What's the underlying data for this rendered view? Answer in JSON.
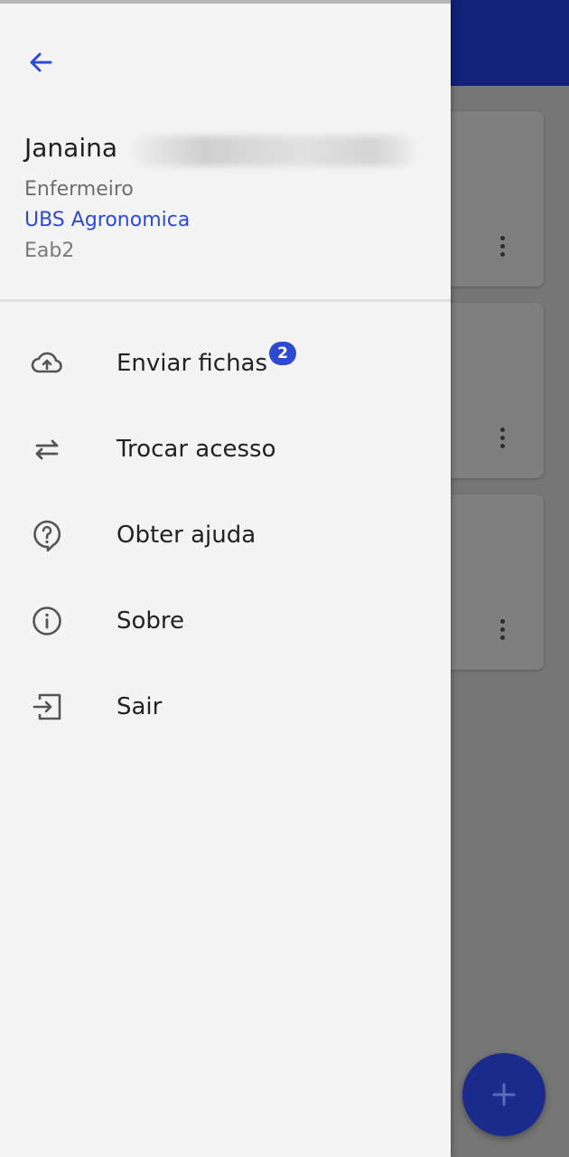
{
  "drawer": {
    "back_icon": "arrow-left-icon",
    "user": {
      "first_name": "Janaina",
      "role": "Enfermeiro",
      "unit": "UBS Agronomica",
      "team": "Eab2"
    },
    "menu": [
      {
        "label": "Enviar fichas",
        "icon": "cloud-upload-icon",
        "badge": "2"
      },
      {
        "label": "Trocar acesso",
        "icon": "swap-arrows-icon"
      },
      {
        "label": "Obter ajuda",
        "icon": "help-circle-icon"
      },
      {
        "label": "Sobre",
        "icon": "info-circle-icon"
      },
      {
        "label": "Sair",
        "icon": "logout-icon"
      }
    ]
  },
  "background": {
    "fab_icon": "plus-icon",
    "card_menu_icon": "more-vertical-icon"
  },
  "colors": {
    "accent": "#2e4ad2",
    "appbar": "#13207a",
    "drawer_bg": "#f4f4f4",
    "scrim": "#767676"
  }
}
